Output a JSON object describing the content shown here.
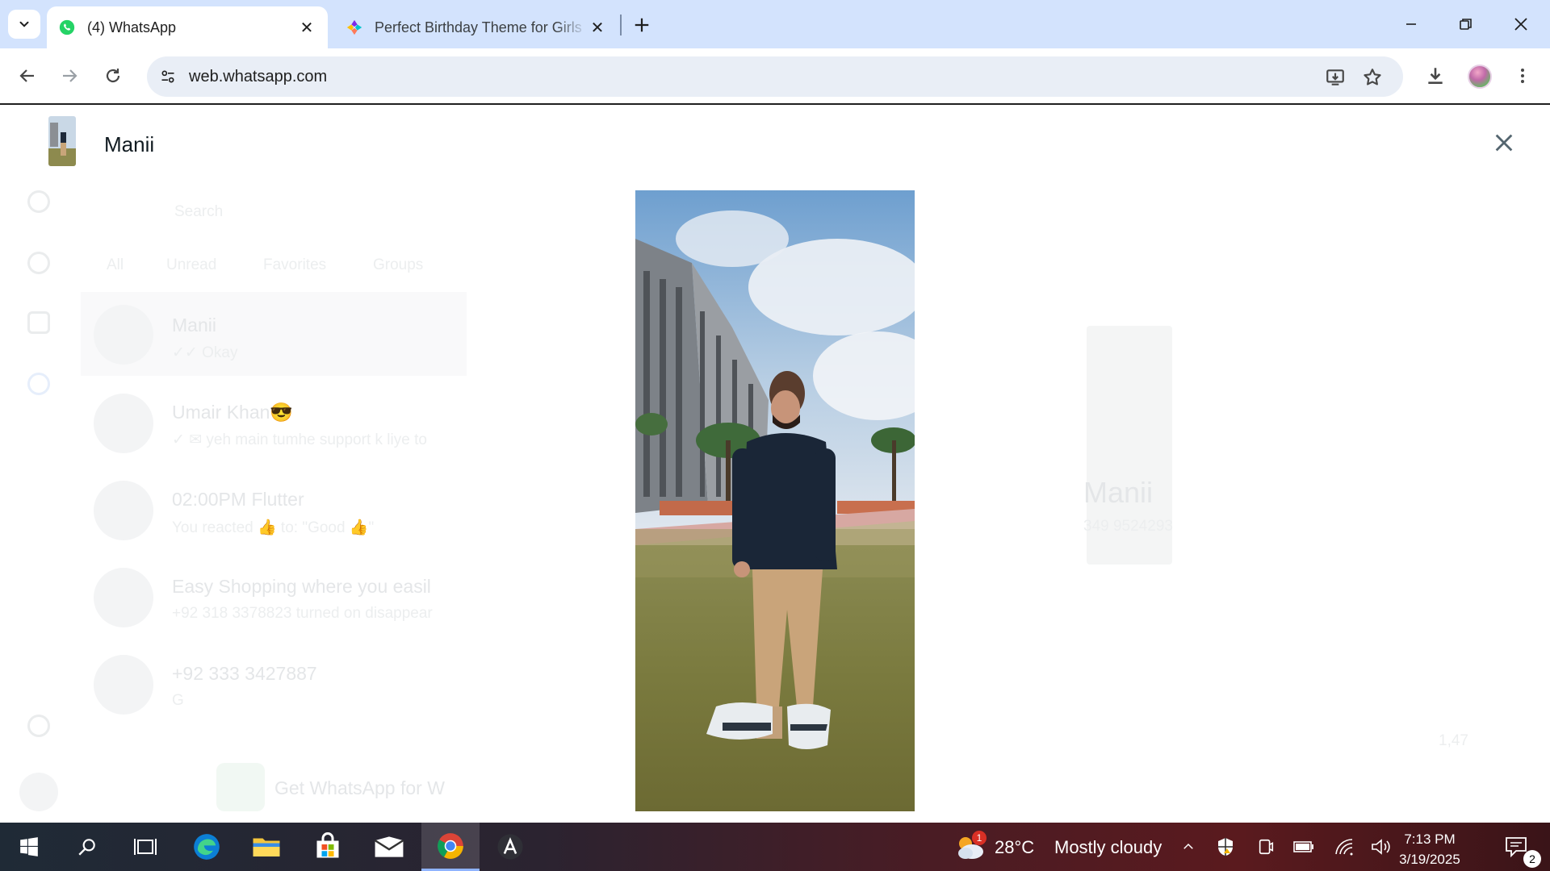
{
  "browser": {
    "tabs": [
      {
        "label": "(4) WhatsApp",
        "active": true,
        "icon": "whatsapp-icon"
      },
      {
        "label": "Perfect Birthday Theme for Girls",
        "active": false,
        "icon": "canva-icon"
      }
    ],
    "url": "web.whatsapp.com"
  },
  "whatsapp_background": {
    "search_placeholder": "Search",
    "filters": [
      "All",
      "Unread",
      "Favorites",
      "Groups"
    ],
    "chats": [
      {
        "name": "Manii",
        "preview": "✓✓ Okay"
      },
      {
        "name": "Umair Khan😎",
        "preview": "✓ ✉ yeh main tumhe support k liye to"
      },
      {
        "name": "02:00PM Flutter",
        "preview": "You reacted 👍 to: \"Good 👍\""
      },
      {
        "name": "Easy Shopping  where you easil",
        "preview": "+92 318 3378823 turned on disappear"
      },
      {
        "name": "+92 333 3427887",
        "preview": "G"
      }
    ],
    "get_app_label": "Get WhatsApp for W",
    "profile_name": "Manii",
    "profile_phone": "349 9524293",
    "media_count": "1,47"
  },
  "viewer": {
    "contact_name": "Manii"
  },
  "taskbar": {
    "weather_temp": "28°C",
    "weather_desc": "Mostly cloudy",
    "weather_badge": "1",
    "time": "7:13 PM",
    "date": "3/19/2025",
    "notifications": "2"
  }
}
